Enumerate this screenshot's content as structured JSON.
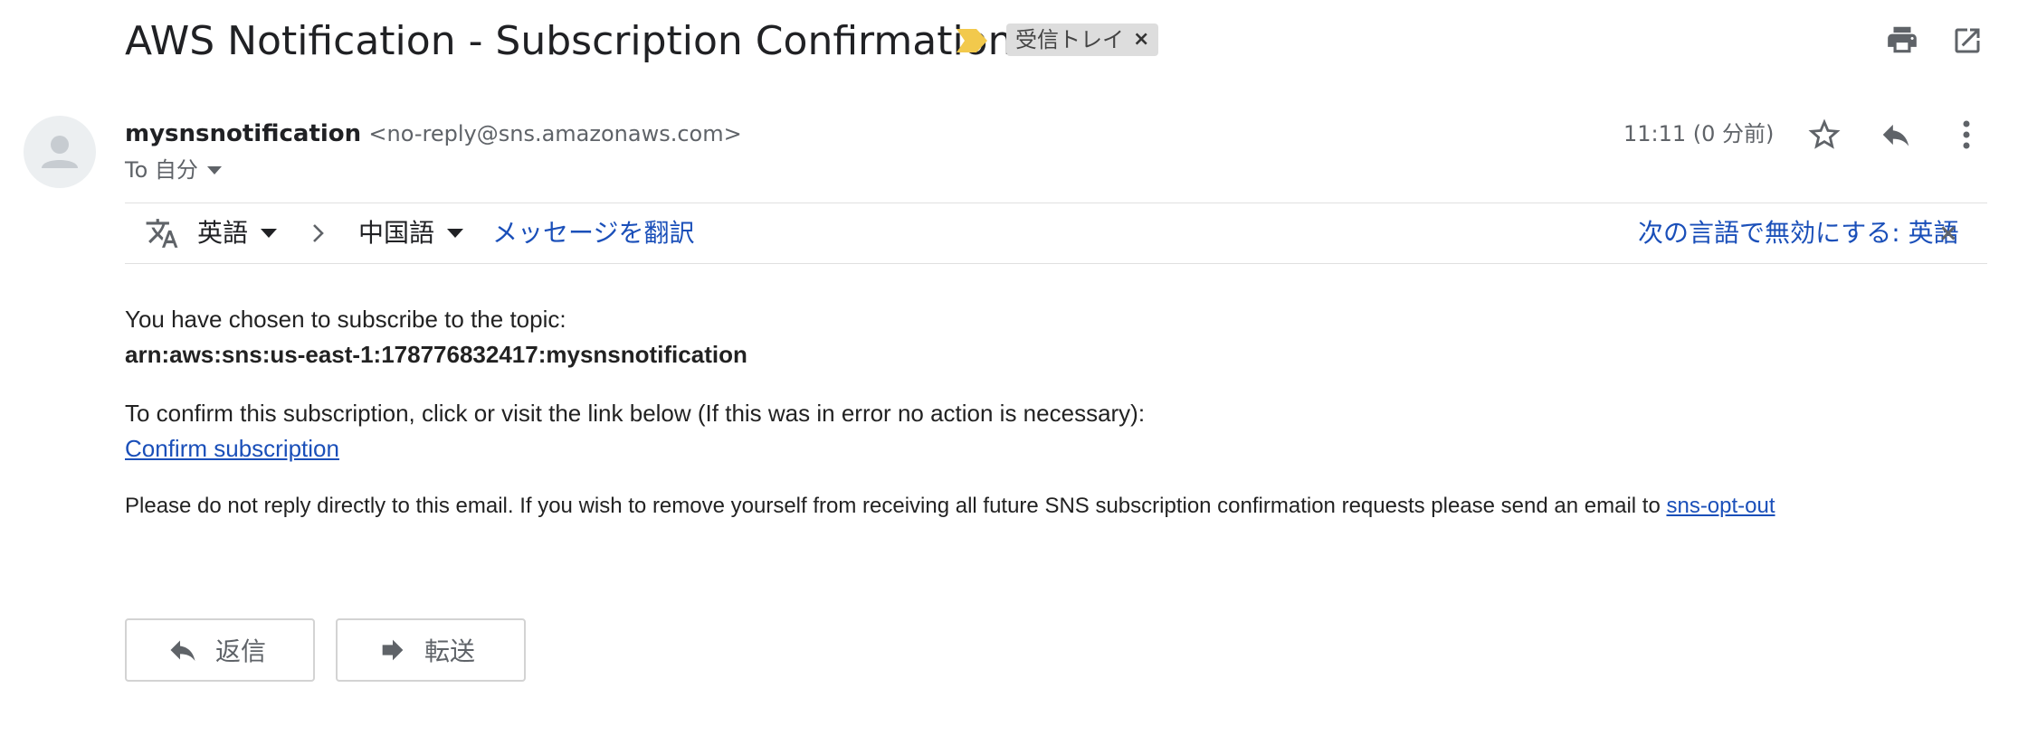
{
  "header": {
    "subject": "AWS Notification - Subscription Confirmation",
    "label": "受信トレイ",
    "label_close": "×"
  },
  "sender": {
    "name": "mysnsnotification",
    "email": "<no-reply@sns.amazonaws.com>",
    "to": "To 自分",
    "timestamp": "11:11 (0 分前)"
  },
  "translate_bar": {
    "source_lang": "英語",
    "target_lang": "中国語",
    "translate_link": "メッセージを翻訳",
    "disable_link": "次の言語で無効にする: 英語",
    "close": "×"
  },
  "body": {
    "line1": "You have chosen to subscribe to the topic:",
    "topic_arn": "arn:aws:sns:us-east-1:178776832417:mysnsnotification",
    "line2": "To confirm this subscription, click or visit the link below (If this was in error no action is necessary):",
    "confirm_link": "Confirm subscription",
    "footer_text": "Please do not reply directly to this email. If you wish to remove yourself from receiving all future SNS subscription confirmation requests please send an email to ",
    "opt_out_link": "sns-opt-out"
  },
  "actions": {
    "reply_label": "返信",
    "forward_label": "転送"
  },
  "colors": {
    "link": "#1a4fb9",
    "label_tag": "#f2c94c",
    "chip_bg": "#dddddd"
  },
  "icons": {
    "label_tag": "label-tag-icon",
    "print": "print-icon",
    "popout": "popout-icon",
    "avatar": "person-icon",
    "star": "star-icon",
    "reply": "reply-icon",
    "more": "more-vert-icon",
    "translate": "translate-icon",
    "forward": "forward-icon"
  }
}
